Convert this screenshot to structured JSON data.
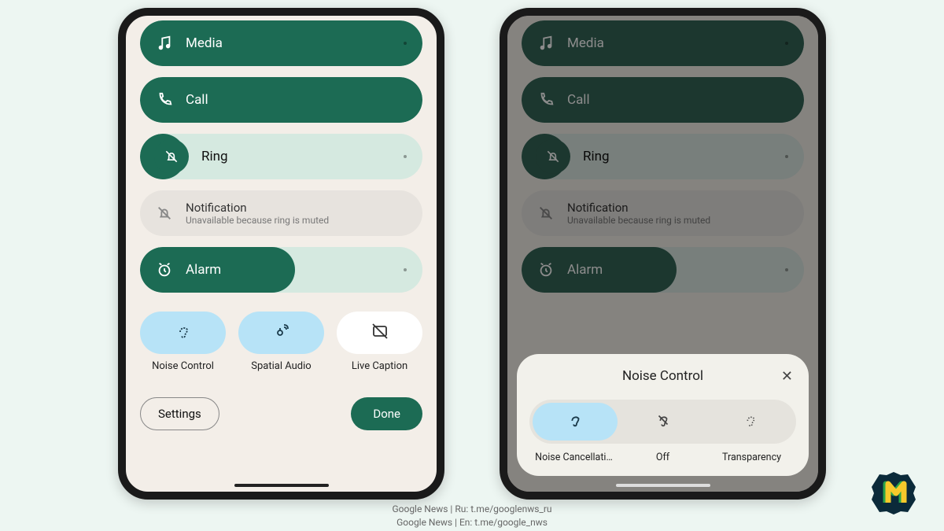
{
  "sliders": {
    "media": {
      "label": "Media",
      "fill": 100
    },
    "call": {
      "label": "Call",
      "fill": 100
    },
    "ring": {
      "label": "Ring"
    },
    "notification": {
      "title": "Notification",
      "subtitle": "Unavailable because ring is muted"
    },
    "alarm": {
      "label": "Alarm",
      "fill": 55
    }
  },
  "features": {
    "noise": "Noise Control",
    "spatial": "Spatial Audio",
    "caption": "Live Caption"
  },
  "buttons": {
    "settings": "Settings",
    "done": "Done"
  },
  "popup": {
    "title": "Noise Control",
    "options": {
      "nc": "Noise Cancellati…",
      "off": "Off",
      "transparency": "Transparency"
    }
  },
  "footer": {
    "line1": "Google News | Ru: t.me/googlenws_ru",
    "line2": "Google News | En: t.me/google_nws"
  }
}
